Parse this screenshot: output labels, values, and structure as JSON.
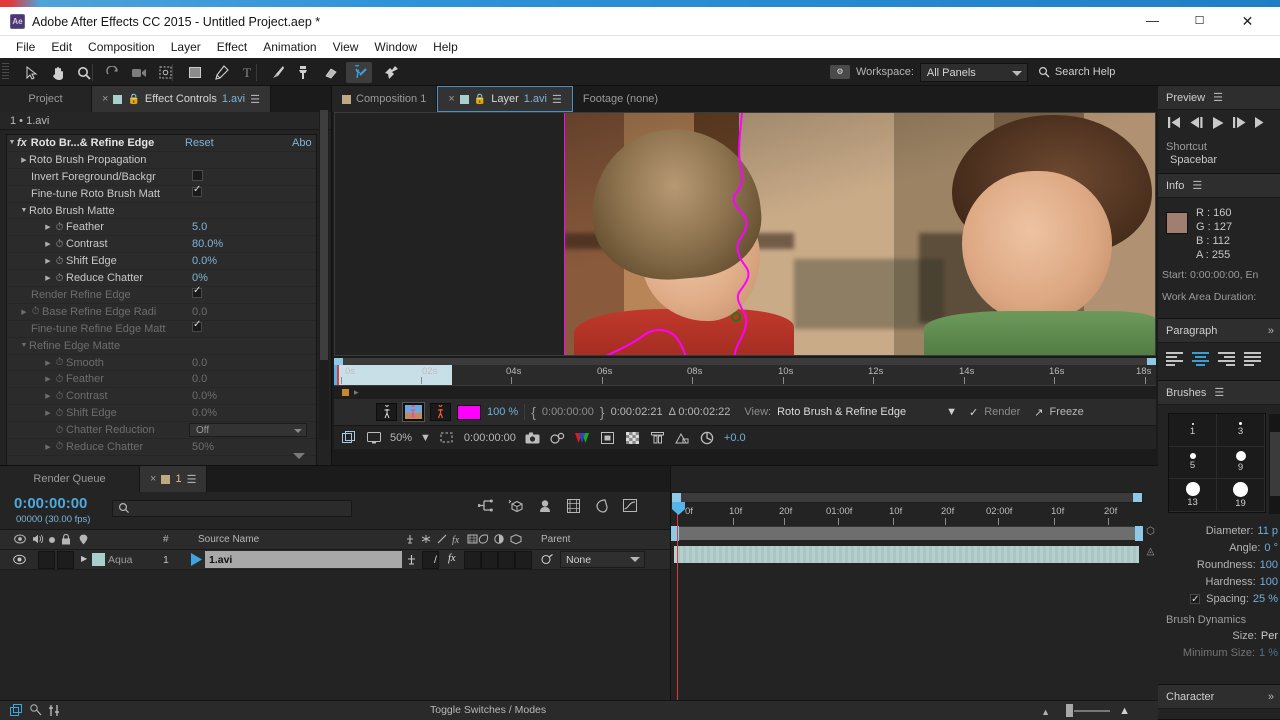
{
  "window": {
    "title": "Adobe After Effects CC 2015 - Untitled Project.aep *",
    "app_icon": "Ae",
    "minimize": "—",
    "maximize": "☐",
    "close": "✕"
  },
  "menu": {
    "items": [
      "File",
      "Edit",
      "Composition",
      "Layer",
      "Effect",
      "Animation",
      "View",
      "Window",
      "Help"
    ]
  },
  "toolbar": {
    "tools": [
      {
        "name": "selection-tool",
        "label": "Selection"
      },
      {
        "name": "hand-tool",
        "label": "Hand"
      },
      {
        "name": "zoom-tool",
        "label": "Zoom"
      },
      {
        "name": "rotation-tool",
        "label": "Rotation"
      },
      {
        "name": "camera-tool",
        "label": "Unified Camera"
      },
      {
        "name": "pan-behind-tool",
        "label": "Pan Behind"
      },
      {
        "name": "shape-tool",
        "label": "Rectangle"
      },
      {
        "name": "pen-tool",
        "label": "Pen"
      },
      {
        "name": "type-tool",
        "label": "Type"
      },
      {
        "name": "brush-tool",
        "label": "Brush"
      },
      {
        "name": "clone-stamp-tool",
        "label": "Clone Stamp"
      },
      {
        "name": "eraser-tool",
        "label": "Eraser"
      },
      {
        "name": "roto-brush-tool",
        "label": "Roto Brush"
      },
      {
        "name": "puppet-pin-tool",
        "label": "Puppet Pin"
      }
    ],
    "selected_tool": "roto-brush-tool",
    "workspace_label": "Workspace:",
    "workspace_value": "All Panels",
    "search_help": "Search Help"
  },
  "effect_controls": {
    "tabs": [
      {
        "label": "Project",
        "active": false,
        "closable": false
      },
      {
        "label": "Effect Controls",
        "file": "1.avi",
        "active": true,
        "closable": true
      }
    ],
    "subtitle": "1 • 1.avi",
    "rows": [
      {
        "indent": 0,
        "tri": "▼",
        "fx": true,
        "label": "Roto Br...& Refine Edge",
        "header": true,
        "reset": "Reset",
        "about": "Abo",
        "dim": false
      },
      {
        "indent": 1,
        "tri": "▶",
        "label": "Roto Brush Propagation",
        "dim": false
      },
      {
        "indent": 2,
        "label": "Invert Foreground/Backgr",
        "control": "swatch",
        "dim": false
      },
      {
        "indent": 2,
        "label": "Fine-tune Roto Brush Matt",
        "control": "check",
        "checked": true,
        "dim": false
      },
      {
        "indent": 1,
        "tri": "▼",
        "label": "Roto Brush Matte",
        "dim": false
      },
      {
        "indent": 2,
        "tri": "▶",
        "stopwatch": true,
        "label": "Feather",
        "value": "5.0",
        "dim": false
      },
      {
        "indent": 2,
        "tri": "▶",
        "stopwatch": true,
        "label": "Contrast",
        "value": "80.0%",
        "dim": false
      },
      {
        "indent": 2,
        "tri": "▶",
        "stopwatch": true,
        "label": "Shift Edge",
        "value": "0.0%",
        "dim": false
      },
      {
        "indent": 2,
        "tri": "▶",
        "stopwatch": true,
        "label": "Reduce Chatter",
        "value": "0%",
        "dim": false
      },
      {
        "indent": 2,
        "label": "Render Refine Edge",
        "control": "check",
        "checked": true,
        "dim": true
      },
      {
        "indent": 1,
        "tri": "▶",
        "stopwatch": true,
        "label": "Base Refine Edge Radi",
        "value": "0.0",
        "dim": true
      },
      {
        "indent": 2,
        "label": "Fine-tune Refine Edge Matt",
        "control": "check",
        "checked": true,
        "dim": true
      },
      {
        "indent": 1,
        "tri": "▼",
        "label": "Refine Edge Matte",
        "dim": true
      },
      {
        "indent": 2,
        "tri": "▶",
        "stopwatch": true,
        "label": "Smooth",
        "value": "0.0",
        "dim": true
      },
      {
        "indent": 2,
        "tri": "▶",
        "stopwatch": true,
        "label": "Feather",
        "value": "0.0",
        "dim": true
      },
      {
        "indent": 2,
        "tri": "▶",
        "stopwatch": true,
        "label": "Contrast",
        "value": "0.0%",
        "dim": true
      },
      {
        "indent": 2,
        "tri": "▶",
        "stopwatch": true,
        "label": "Shift Edge",
        "value": "0.0%",
        "dim": true
      },
      {
        "indent": 2,
        "stopwatch": true,
        "label": "Chatter Reduction",
        "control": "dropdown",
        "value": "Off",
        "dim": true
      },
      {
        "indent": 2,
        "tri": "▶",
        "stopwatch": true,
        "label": "Reduce Chatter",
        "value": "50%",
        "dim": true
      }
    ]
  },
  "viewer": {
    "tabs": [
      {
        "label": "Composition 1",
        "active": false,
        "closable": false,
        "swatch": "#c0a882"
      },
      {
        "label": "Layer",
        "file": "1.avi",
        "active": true,
        "closable": true,
        "swatch": "#a8cfcb"
      },
      {
        "label": "Footage (none)",
        "active": false,
        "closable": false
      }
    ],
    "ruler_ticks": [
      "0s",
      "02s",
      "04s",
      "06s",
      "08s",
      "10s",
      "12s",
      "14s",
      "16s",
      "18s"
    ],
    "controls": {
      "alpha_buttons": [
        "alpha-boundary",
        "alpha-overlay",
        "alpha-channel"
      ],
      "overlay_color": "#ff00ff",
      "opacity": "100 %",
      "in_point": "0:00:00:00",
      "out_point": "0:00:02:21",
      "duration": "Δ 0:00:02:22",
      "view_label": "View:",
      "view_value": "Roto Brush & Refine Edge",
      "render_label": "Render",
      "render_checked": true,
      "freeze_label": "Freeze"
    },
    "bottombar": {
      "magnification": "50%",
      "current_time": "0:00:00:00",
      "exposure": "+0.0"
    }
  },
  "preview": {
    "title": "Preview",
    "transport": [
      "first-frame",
      "previous-frame",
      "play",
      "next-frame",
      "last-frame"
    ],
    "shortcut_label": "Shortcut",
    "shortcut_value": "Spacebar"
  },
  "info": {
    "title": "Info",
    "color": {
      "r": "R : 160",
      "g": "G : 127",
      "b": "B : 112",
      "a": "A : 255"
    },
    "swatch_hex": "#a07f70",
    "line1": "Start: 0:00:00:00, En",
    "line2": "Work Area Duration:"
  },
  "paragraph": {
    "title": "Paragraph",
    "buttons": [
      "align-left",
      "align-center",
      "align-right",
      "justify-last-left"
    ],
    "selected": "align-center",
    "accent": "#3b9fd6"
  },
  "brushes": {
    "title": "Brushes",
    "presets": [
      {
        "size": "1",
        "dot": 2
      },
      {
        "size": "3",
        "dot": 3
      },
      {
        "size": "5",
        "dot": 6
      },
      {
        "size": "9",
        "dot": 10
      },
      {
        "size": "13",
        "dot": 14
      },
      {
        "size": "19",
        "dot": 16
      }
    ],
    "properties": [
      {
        "label": "Diameter:",
        "value": "11 p"
      },
      {
        "label": "Angle:",
        "value": "0 °"
      },
      {
        "label": "Roundness:",
        "value": "100"
      },
      {
        "label": "Hardness:",
        "value": "100"
      },
      {
        "label": "Spacing:",
        "value": "25 %",
        "checked": true
      }
    ],
    "dynamics_title": "Brush Dynamics",
    "dynamics": [
      {
        "label": "Size:",
        "value": "Per"
      },
      {
        "label": "Minimum Size:",
        "value": "1 %"
      }
    ]
  },
  "character": {
    "title": "Character"
  },
  "timeline": {
    "tabs": [
      {
        "label": "Render Queue",
        "active": false,
        "closable": false
      },
      {
        "label": "1",
        "active": true,
        "closable": true,
        "swatch": "#c0a882"
      }
    ],
    "current_time": "0:00:00:00",
    "frame_info": "00000 (30.00 fps)",
    "columns": [
      "#",
      "Source Name",
      "Parent"
    ],
    "layers": [
      {
        "index": "1",
        "label": "Aqua",
        "source_name": "1.avi",
        "parent": "None",
        "color": "#a8cfcb"
      }
    ],
    "ruler_labels": [
      "0f",
      "10f",
      "20f",
      "01:00f",
      "10f",
      "20f",
      "02:00f",
      "10f",
      "20f"
    ],
    "toggle_switches": "Toggle Switches / Modes"
  }
}
